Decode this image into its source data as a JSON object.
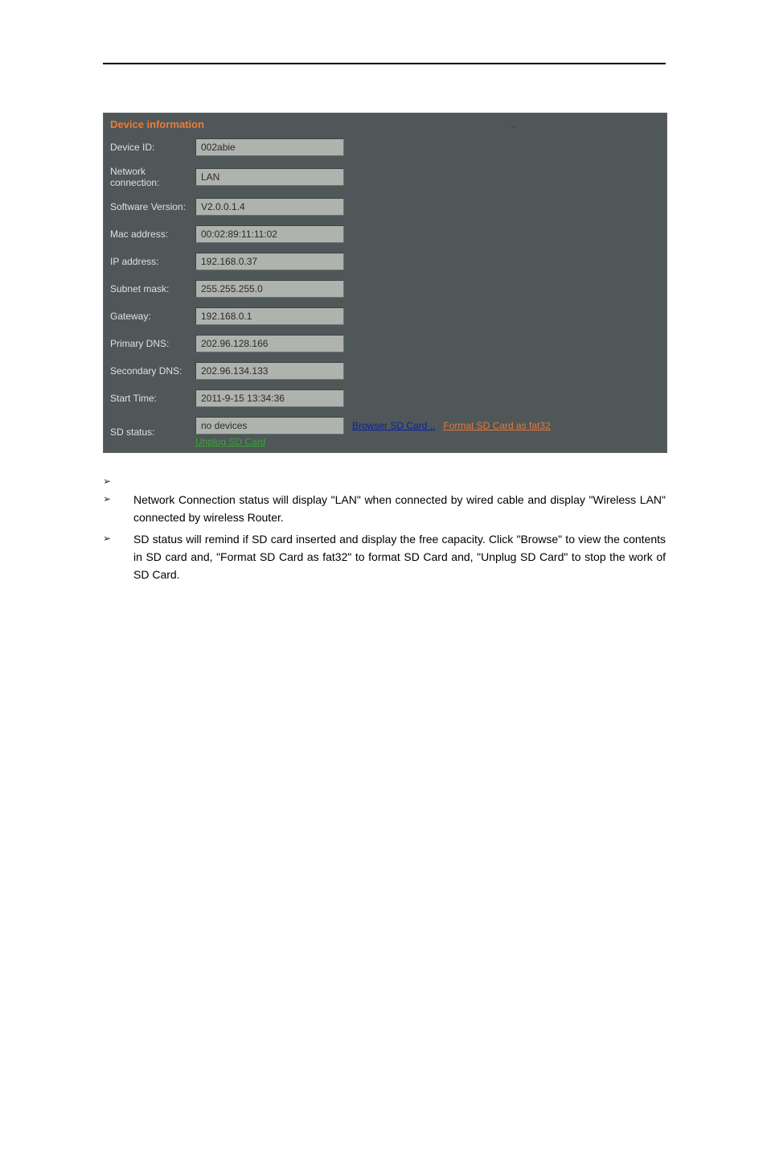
{
  "header_dash": "_",
  "panel": {
    "title": "Device information",
    "rows": {
      "device_id": {
        "label": "Device ID:",
        "value": "002abie"
      },
      "network_connection": {
        "label": "Network connection:",
        "value": "LAN"
      },
      "software_version": {
        "label": "Software Version:",
        "value": "V2.0.0.1.4"
      },
      "mac_address": {
        "label": "Mac address:",
        "value": "00:02:89:11:11:02"
      },
      "ip_address": {
        "label": "IP address:",
        "value": "192.168.0.37"
      },
      "subnet_mask": {
        "label": "Subnet mask:",
        "value": "255.255.255.0"
      },
      "gateway": {
        "label": "Gateway:",
        "value": "192.168.0.1"
      },
      "primary_dns": {
        "label": "Primary DNS:",
        "value": "202.96.128.166"
      },
      "secondary_dns": {
        "label": "Secondary DNS:",
        "value": "202.96.134.133"
      },
      "start_time": {
        "label": "Start Time:",
        "value": "2011-9-15 13:34:36"
      },
      "sd_status": {
        "label": "SD status:",
        "value": "no devices",
        "browse": "Browser SD Card ..",
        "format": "Format SD Card as fat32",
        "unplug": "Unplug SD Card"
      }
    }
  },
  "bullets": {
    "b2": "Network Connection status will display \"LAN\" when connected by wired cable and display \"Wireless LAN\" connected by wireless Router.",
    "b3": "SD status will remind if SD card inserted and display the free capacity. Click \"Browse\" to view the contents in SD card and, \"Format SD Card as fat32\" to format SD Card and, \"Unplug SD Card\" to stop the work of SD Card."
  }
}
